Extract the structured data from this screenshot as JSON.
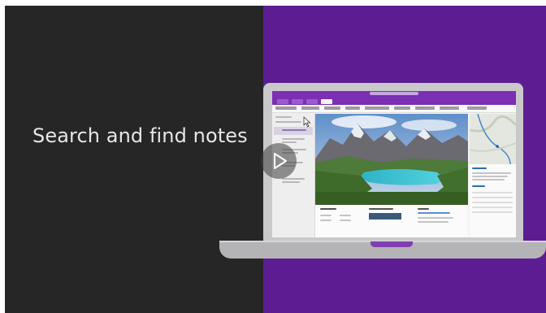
{
  "video": {
    "headline": "Search and find notes",
    "play_icon": "play-icon"
  },
  "colors": {
    "left_panel": "#262626",
    "right_panel": "#5c1d92",
    "onenote_purple": "#7b2fb3"
  }
}
